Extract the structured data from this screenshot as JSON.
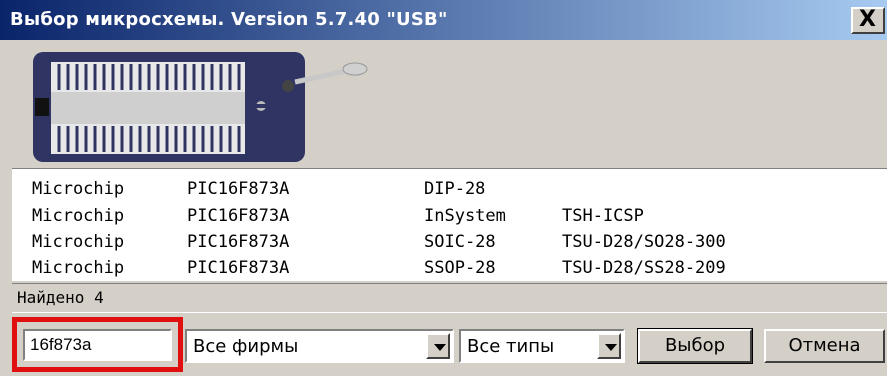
{
  "window": {
    "title": "Выбор микросхемы. Version  5.7.40 \"USB\"",
    "close_label": "X"
  },
  "devices": [
    {
      "maker": "Microchip",
      "chip": "PIC16F873A",
      "package": "DIP-28",
      "adapter": ""
    },
    {
      "maker": "Microchip",
      "chip": "PIC16F873A",
      "package": "InSystem",
      "adapter": "TSH-ICSP"
    },
    {
      "maker": "Microchip",
      "chip": "PIC16F873A",
      "package": "SOIC-28",
      "adapter": "TSU-D28/SO28-300"
    },
    {
      "maker": "Microchip",
      "chip": "PIC16F873A",
      "package": "SSOP-28",
      "adapter": "TSU-D28/SS28-209"
    }
  ],
  "status": {
    "found_text": "Найдено 4"
  },
  "search": {
    "value": "16f873a"
  },
  "filters": {
    "vendor_selected": "Все фирмы",
    "type_selected": "Все типы"
  },
  "buttons": {
    "select_label": "Выбор",
    "cancel_label": "Отмена"
  },
  "colors": {
    "highlight": "#e01010",
    "titlebar_start": "#0a246a",
    "titlebar_end": "#a6caf0"
  }
}
